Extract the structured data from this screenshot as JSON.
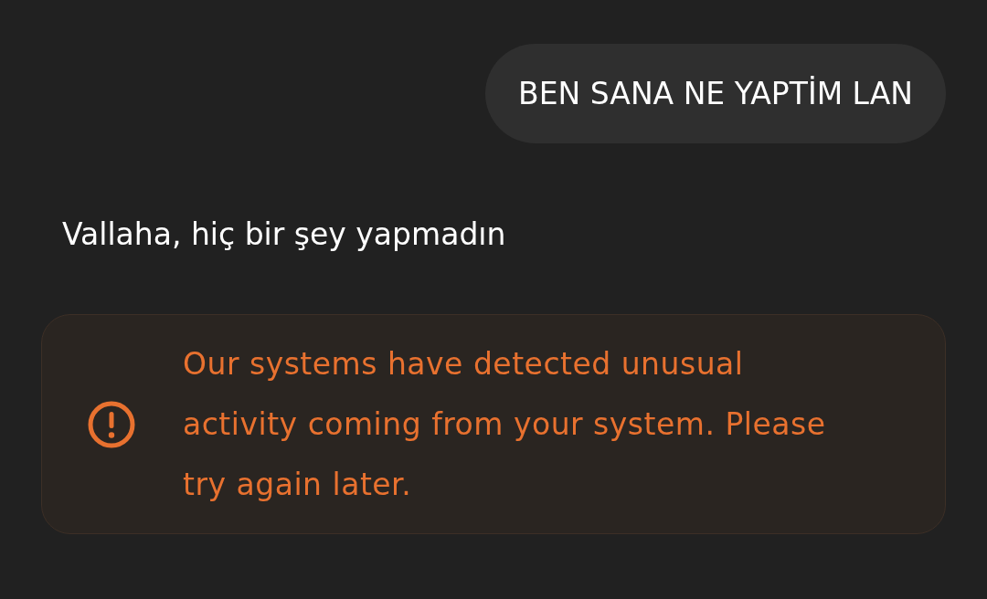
{
  "messages": [
    {
      "kind": "user",
      "text": "BEN SANA NE YAPTİM LAN"
    },
    {
      "kind": "assistant",
      "text": "Vallaha, hiç bir şey yapmadın"
    },
    {
      "kind": "error",
      "text": "Our systems have detected unusual activity coming from your system. Please try again later."
    }
  ]
}
